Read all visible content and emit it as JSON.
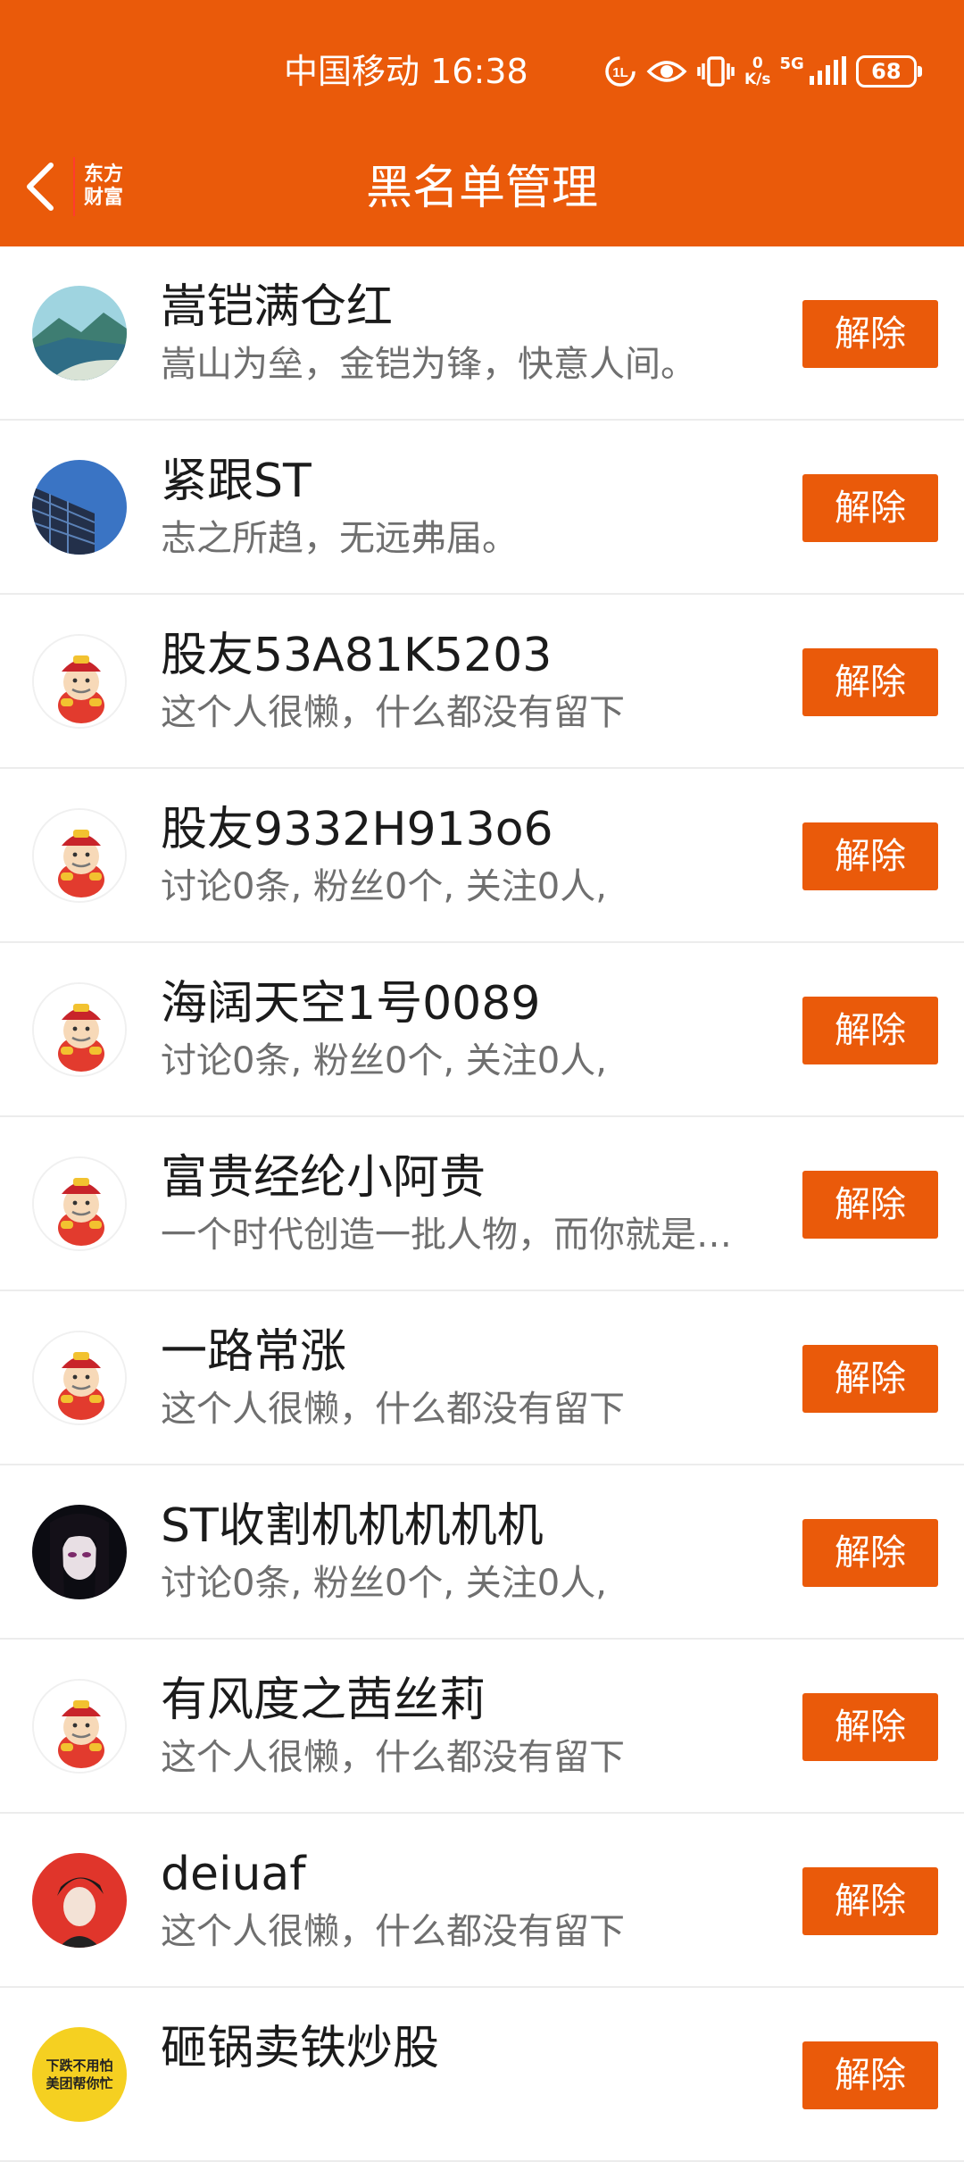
{
  "status_bar": {
    "carrier": "中国移动",
    "time": "16:38",
    "net_speed_value": "0",
    "net_speed_unit": "K/s",
    "network_type": "5G",
    "battery": "68",
    "icons": [
      "hd-voice-icon",
      "eye-comfort-icon",
      "vibrate-icon",
      "network-speed-icon",
      "signal-icon",
      "battery-icon"
    ]
  },
  "header": {
    "title": "黑名单管理",
    "back_icon": "chevron-left-icon",
    "logo_line1": "东方",
    "logo_line2": "财富"
  },
  "colors": {
    "accent": "#ea5a0a",
    "name_text": "#1b1b1b",
    "bio_text": "#6f6f6f",
    "divider": "#ececec"
  },
  "blocked_users": [
    {
      "name": "嵩铠满仓红",
      "bio": "嵩山为垒，金铠为锋，快意人间。",
      "avatar": "landscape-photo",
      "button": "解除"
    },
    {
      "name": "紧跟ST",
      "bio": "志之所趋，无远弗届。",
      "avatar": "building-sky-photo",
      "button": "解除"
    },
    {
      "name": "股友53A81K5203",
      "bio": "这个人很懒，什么都没有留下",
      "avatar": "default-mascot",
      "button": "解除"
    },
    {
      "name": "股友9332H913o6",
      "bio": "讨论0条, 粉丝0个, 关注0人,",
      "avatar": "default-mascot",
      "button": "解除"
    },
    {
      "name": "海阔天空1号0089",
      "bio": "讨论0条, 粉丝0个, 关注0人,",
      "avatar": "default-mascot",
      "button": "解除"
    },
    {
      "name": "富贵经纶小阿贵",
      "bio": "一个时代创造一批人物，而你就是…",
      "avatar": "default-mascot",
      "button": "解除"
    },
    {
      "name": "一路常涨",
      "bio": "这个人很懒，什么都没有留下",
      "avatar": "default-mascot",
      "button": "解除"
    },
    {
      "name": "ST收割机机机机机",
      "bio": "讨论0条, 粉丝0个, 关注0人,",
      "avatar": "dark-anime-portrait",
      "button": "解除"
    },
    {
      "name": "有风度之茜丝莉",
      "bio": "这个人很懒，什么都没有留下",
      "avatar": "default-mascot",
      "button": "解除"
    },
    {
      "name": "deiuaf",
      "bio": "这个人很懒，什么都没有留下",
      "avatar": "red-portrait",
      "button": "解除"
    },
    {
      "name": "砸锅卖铁炒股",
      "bio": "",
      "avatar": "yellow-text-badge",
      "avatar_text_line1": "下跌不用怕",
      "avatar_text_line2": "美团帮你忙",
      "button": "解除"
    }
  ]
}
